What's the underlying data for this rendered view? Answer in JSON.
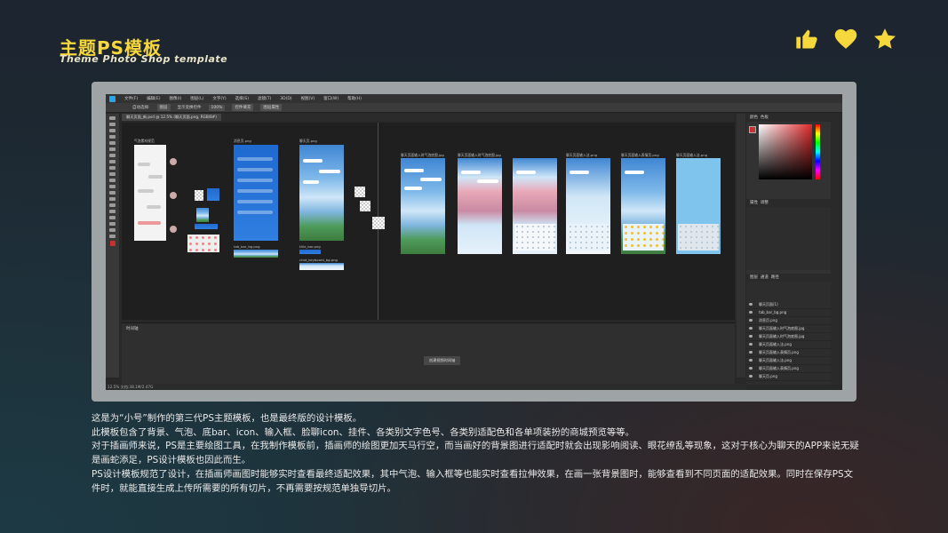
{
  "header": {
    "title_cn": "主题PS模板",
    "title_en": "Theme Photo Shop template"
  },
  "reactions": [
    {
      "icon": "thumbs-up-icon",
      "color": "#f6d73c"
    },
    {
      "icon": "heart-icon",
      "color": "#f6d73c"
    },
    {
      "icon": "star-icon",
      "color": "#f6d73c"
    }
  ],
  "colors": {
    "accent": "#f6d73c",
    "frame": "#9ea3a6",
    "ps_background": "#282828"
  },
  "screenshot": {
    "menu": [
      "文件(F)",
      "编辑(E)",
      "图像(I)",
      "图层(L)",
      "文字(Y)",
      "选择(S)",
      "滤镜(T)",
      "3D(D)",
      "视图(V)",
      "窗口(W)",
      "帮助(H)"
    ],
    "options": [
      "自动选择:",
      "图层",
      "显示变换控件",
      "100%",
      "控件填充",
      "图层属性"
    ],
    "doc_tab": "聊天页面_新.psd @ 12.5% (聊天页面.png, RGB/8#)",
    "artboard_labels": [
      "气泡素材规范",
      "消息页.png",
      "聊天页.png",
      "聊天页面输入时气泡底图.jpg",
      "聊天页面输入时气泡底图.jpg",
      "聊天页面输入法.png",
      "聊天页面输入表情页.png",
      "聊天页面输入法.png",
      "tab_bar_bg.png",
      "title_bar.png",
      "chat_keyboard_bg.png"
    ],
    "timeline_title": "时间轴",
    "timeline_button": "创建视频时间轴",
    "status": "12.5%  文档:38.1M/2.47G",
    "panel_tabs": [
      "颜色",
      "色板",
      "属性",
      "调整",
      "图层",
      "通道",
      "路径"
    ],
    "layers": [
      "聊天页面(1)",
      "tab_bar_bg.png",
      "消息页.png",
      "聊天页面输入时气泡底图.jpg",
      "聊天页面输入时气泡底图.jpg",
      "聊天页面输入法.png",
      "聊天页面输入表情页.png",
      "聊天页面输入法.png",
      "聊天页面输入表情页.png",
      "聊天页.png"
    ]
  },
  "description": [
    "这是为“小号”制作的第三代PS主题模板，也是最终版的设计模板。",
    "此模板包含了背景、气泡、底bar、icon、输入框、脸聊icon、挂件、各类别文字色号、各类别适配色和各单项装扮的商城预览等等。",
    "对于插画师来说，PS是主要绘图工具，在我制作模板前，插画师的绘图更加天马行空，而当画好的背景图进行适配时就会出现影响阅读、眼花缭乱等现象，这对于核心为聊天的APP来说无疑是画蛇添足，PS设计模板也因此而生。",
    "PS设计模板规范了设计，在插画师画图时能够实时查看最终适配效果，其中气泡、输入框等也能实时查看拉伸效果，在画一张背景图时，能够查看到不同页面的适配效果。同时在保存PS文件时，就能直接生成上传所需要的所有切片，不再需要按规范单独导切片。"
  ]
}
